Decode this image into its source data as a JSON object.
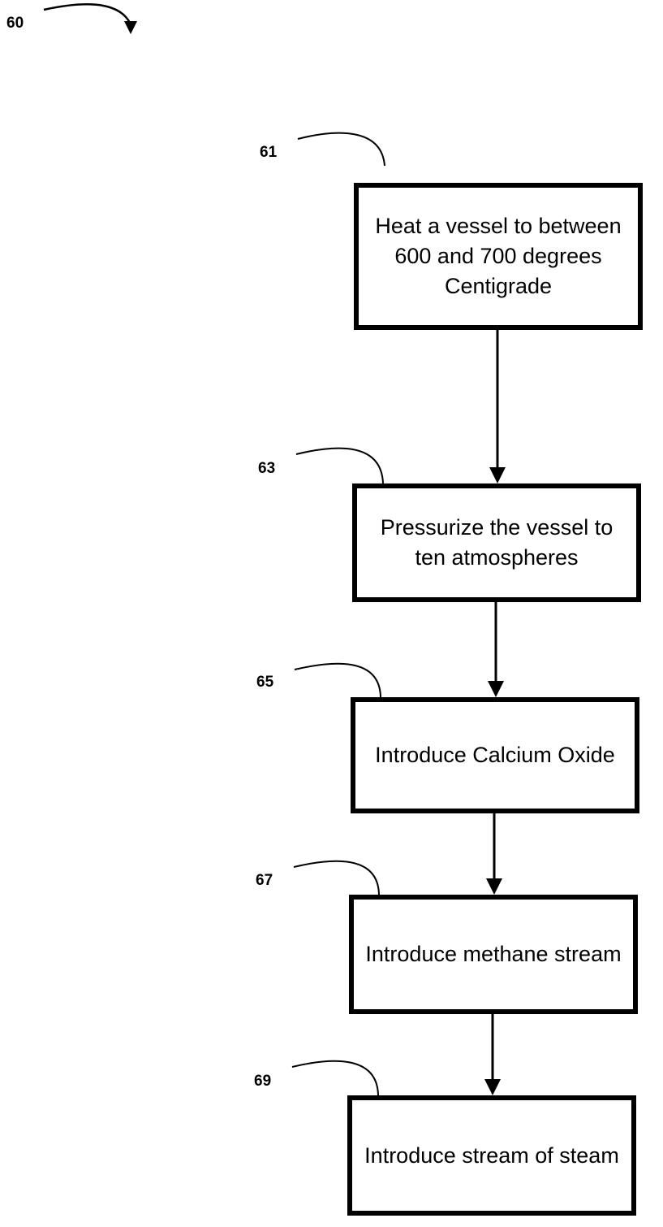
{
  "figure": {
    "ref": "60",
    "steps": [
      {
        "ref": "61",
        "text": "Heat a vessel to between 600 and 700 degrees Centigrade"
      },
      {
        "ref": "63",
        "text": "Pressurize the vessel to ten atmospheres"
      },
      {
        "ref": "65",
        "text": "Introduce Calcium Oxide"
      },
      {
        "ref": "67",
        "text": "Introduce methane stream"
      },
      {
        "ref": "69",
        "text": "Introduce stream of steam"
      }
    ]
  }
}
